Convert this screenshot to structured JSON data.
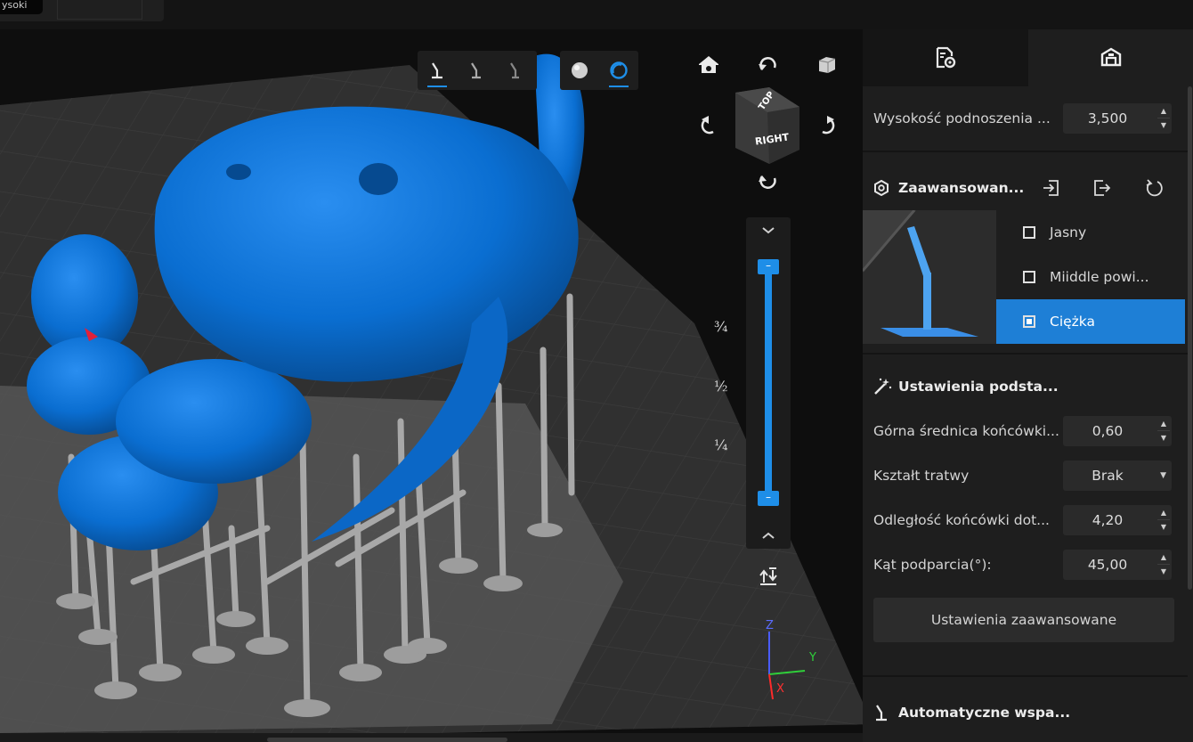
{
  "top": {
    "fragment_label": "ysoki"
  },
  "viewcube": {
    "top": "TOP",
    "right": "RIGHT"
  },
  "slider": {
    "fractions": [
      "¾",
      "½",
      "¼"
    ],
    "handle_top": "–",
    "handle_bottom": "–"
  },
  "axes": {
    "z": "Z",
    "y": "Y",
    "x": "X"
  },
  "panel": {
    "lift_height": {
      "label": "Wysokość podnoszenia ...",
      "value": "3,500"
    },
    "advanced": {
      "title": "Zaawansowan...",
      "options": [
        {
          "label": "Jasny",
          "selected": false
        },
        {
          "label": "Miiddle powi...",
          "selected": false
        },
        {
          "label": "Ciężka",
          "selected": true
        }
      ]
    },
    "basic": {
      "title": "Ustawienia podsta...",
      "fields": [
        {
          "label": "Górna średnica końcówki...",
          "value": "0,60"
        },
        {
          "label": "Kształt tratwy",
          "value": "Brak"
        },
        {
          "label": "Odległość końcówki dot...",
          "value": "4,20"
        },
        {
          "label": "Kąt podparcia(°):",
          "value": "45,00"
        }
      ],
      "advanced_button": "Ustawienia zaawansowane"
    },
    "auto": {
      "title": "Automatyczne wspa..."
    }
  },
  "colors": {
    "accent": "#1e8ee8",
    "model": "#0a6ed1",
    "support": "#a9a9a9"
  }
}
